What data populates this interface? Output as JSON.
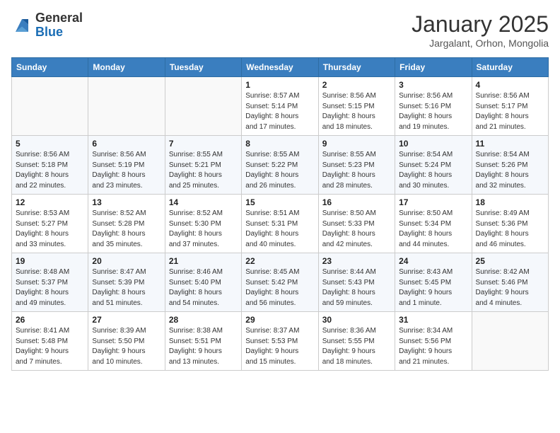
{
  "header": {
    "logo_line1": "General",
    "logo_line2": "Blue",
    "month": "January 2025",
    "location": "Jargalant, Orhon, Mongolia"
  },
  "weekdays": [
    "Sunday",
    "Monday",
    "Tuesday",
    "Wednesday",
    "Thursday",
    "Friday",
    "Saturday"
  ],
  "weeks": [
    [
      {
        "day": "",
        "info": ""
      },
      {
        "day": "",
        "info": ""
      },
      {
        "day": "",
        "info": ""
      },
      {
        "day": "1",
        "info": "Sunrise: 8:57 AM\nSunset: 5:14 PM\nDaylight: 8 hours\nand 17 minutes."
      },
      {
        "day": "2",
        "info": "Sunrise: 8:56 AM\nSunset: 5:15 PM\nDaylight: 8 hours\nand 18 minutes."
      },
      {
        "day": "3",
        "info": "Sunrise: 8:56 AM\nSunset: 5:16 PM\nDaylight: 8 hours\nand 19 minutes."
      },
      {
        "day": "4",
        "info": "Sunrise: 8:56 AM\nSunset: 5:17 PM\nDaylight: 8 hours\nand 21 minutes."
      }
    ],
    [
      {
        "day": "5",
        "info": "Sunrise: 8:56 AM\nSunset: 5:18 PM\nDaylight: 8 hours\nand 22 minutes."
      },
      {
        "day": "6",
        "info": "Sunrise: 8:56 AM\nSunset: 5:19 PM\nDaylight: 8 hours\nand 23 minutes."
      },
      {
        "day": "7",
        "info": "Sunrise: 8:55 AM\nSunset: 5:21 PM\nDaylight: 8 hours\nand 25 minutes."
      },
      {
        "day": "8",
        "info": "Sunrise: 8:55 AM\nSunset: 5:22 PM\nDaylight: 8 hours\nand 26 minutes."
      },
      {
        "day": "9",
        "info": "Sunrise: 8:55 AM\nSunset: 5:23 PM\nDaylight: 8 hours\nand 28 minutes."
      },
      {
        "day": "10",
        "info": "Sunrise: 8:54 AM\nSunset: 5:24 PM\nDaylight: 8 hours\nand 30 minutes."
      },
      {
        "day": "11",
        "info": "Sunrise: 8:54 AM\nSunset: 5:26 PM\nDaylight: 8 hours\nand 32 minutes."
      }
    ],
    [
      {
        "day": "12",
        "info": "Sunrise: 8:53 AM\nSunset: 5:27 PM\nDaylight: 8 hours\nand 33 minutes."
      },
      {
        "day": "13",
        "info": "Sunrise: 8:52 AM\nSunset: 5:28 PM\nDaylight: 8 hours\nand 35 minutes."
      },
      {
        "day": "14",
        "info": "Sunrise: 8:52 AM\nSunset: 5:30 PM\nDaylight: 8 hours\nand 37 minutes."
      },
      {
        "day": "15",
        "info": "Sunrise: 8:51 AM\nSunset: 5:31 PM\nDaylight: 8 hours\nand 40 minutes."
      },
      {
        "day": "16",
        "info": "Sunrise: 8:50 AM\nSunset: 5:33 PM\nDaylight: 8 hours\nand 42 minutes."
      },
      {
        "day": "17",
        "info": "Sunrise: 8:50 AM\nSunset: 5:34 PM\nDaylight: 8 hours\nand 44 minutes."
      },
      {
        "day": "18",
        "info": "Sunrise: 8:49 AM\nSunset: 5:36 PM\nDaylight: 8 hours\nand 46 minutes."
      }
    ],
    [
      {
        "day": "19",
        "info": "Sunrise: 8:48 AM\nSunset: 5:37 PM\nDaylight: 8 hours\nand 49 minutes."
      },
      {
        "day": "20",
        "info": "Sunrise: 8:47 AM\nSunset: 5:39 PM\nDaylight: 8 hours\nand 51 minutes."
      },
      {
        "day": "21",
        "info": "Sunrise: 8:46 AM\nSunset: 5:40 PM\nDaylight: 8 hours\nand 54 minutes."
      },
      {
        "day": "22",
        "info": "Sunrise: 8:45 AM\nSunset: 5:42 PM\nDaylight: 8 hours\nand 56 minutes."
      },
      {
        "day": "23",
        "info": "Sunrise: 8:44 AM\nSunset: 5:43 PM\nDaylight: 8 hours\nand 59 minutes."
      },
      {
        "day": "24",
        "info": "Sunrise: 8:43 AM\nSunset: 5:45 PM\nDaylight: 9 hours\nand 1 minute."
      },
      {
        "day": "25",
        "info": "Sunrise: 8:42 AM\nSunset: 5:46 PM\nDaylight: 9 hours\nand 4 minutes."
      }
    ],
    [
      {
        "day": "26",
        "info": "Sunrise: 8:41 AM\nSunset: 5:48 PM\nDaylight: 9 hours\nand 7 minutes."
      },
      {
        "day": "27",
        "info": "Sunrise: 8:39 AM\nSunset: 5:50 PM\nDaylight: 9 hours\nand 10 minutes."
      },
      {
        "day": "28",
        "info": "Sunrise: 8:38 AM\nSunset: 5:51 PM\nDaylight: 9 hours\nand 13 minutes."
      },
      {
        "day": "29",
        "info": "Sunrise: 8:37 AM\nSunset: 5:53 PM\nDaylight: 9 hours\nand 15 minutes."
      },
      {
        "day": "30",
        "info": "Sunrise: 8:36 AM\nSunset: 5:55 PM\nDaylight: 9 hours\nand 18 minutes."
      },
      {
        "day": "31",
        "info": "Sunrise: 8:34 AM\nSunset: 5:56 PM\nDaylight: 9 hours\nand 21 minutes."
      },
      {
        "day": "",
        "info": ""
      }
    ]
  ]
}
